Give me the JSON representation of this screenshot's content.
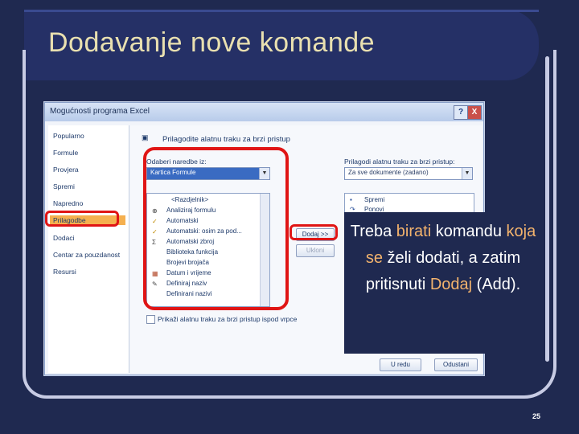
{
  "slide": {
    "title": "Dodavanje nove komande",
    "page_number": "25"
  },
  "dialog": {
    "title": "Mogućnosti programa Excel",
    "help_button": "?",
    "close_button": "X",
    "nav": [
      "Popularno",
      "Formule",
      "Provjera",
      "Spremi",
      "Napredno",
      "Prilagodbe",
      "Dodaci",
      "Centar za pouzdanost",
      "Resursi"
    ],
    "nav_selected": "Prilagodbe",
    "header": "Prilagodite alatnu traku za brzi pristup",
    "choose_label": "Odaberi naredbe iz:",
    "choose_value": "Kartica Formule",
    "customize_label": "Prilagodi alatnu traku za brzi pristup:",
    "customize_value": "Za sve dokumente (zadano)",
    "commands": [
      "<Razdjelnik>",
      "Analiziraj formulu",
      "Automatski",
      "Automatski: osim za pod...",
      "Automatski zbroj",
      "Biblioteka funkcija",
      "Brojevi brojača",
      "Datum i vrijeme",
      "Definiraj naziv",
      "Definirani nazivi"
    ],
    "right_list": [
      "Spremi",
      "Ponovi"
    ],
    "add_button": "Dodaj >>",
    "remove_button": "Ukloni",
    "show_below": "Prikaži alatnu traku za brzi pristup ispod vrpce",
    "ok_button": "U redu",
    "cancel_button": "Odustani"
  },
  "callout": {
    "part1": "Treba ",
    "hl1": "birati",
    "part2": " komandu ",
    "hl2": "koja se",
    "part3": " želi dodati, a zatim pritisnuti ",
    "hl3": "Dodaj",
    "part4": " (Add)."
  },
  "colors": {
    "background": "#1f2950",
    "title_text": "#e9e0b0",
    "highlight": "#f3b36d",
    "red_frame": "#e01515"
  }
}
